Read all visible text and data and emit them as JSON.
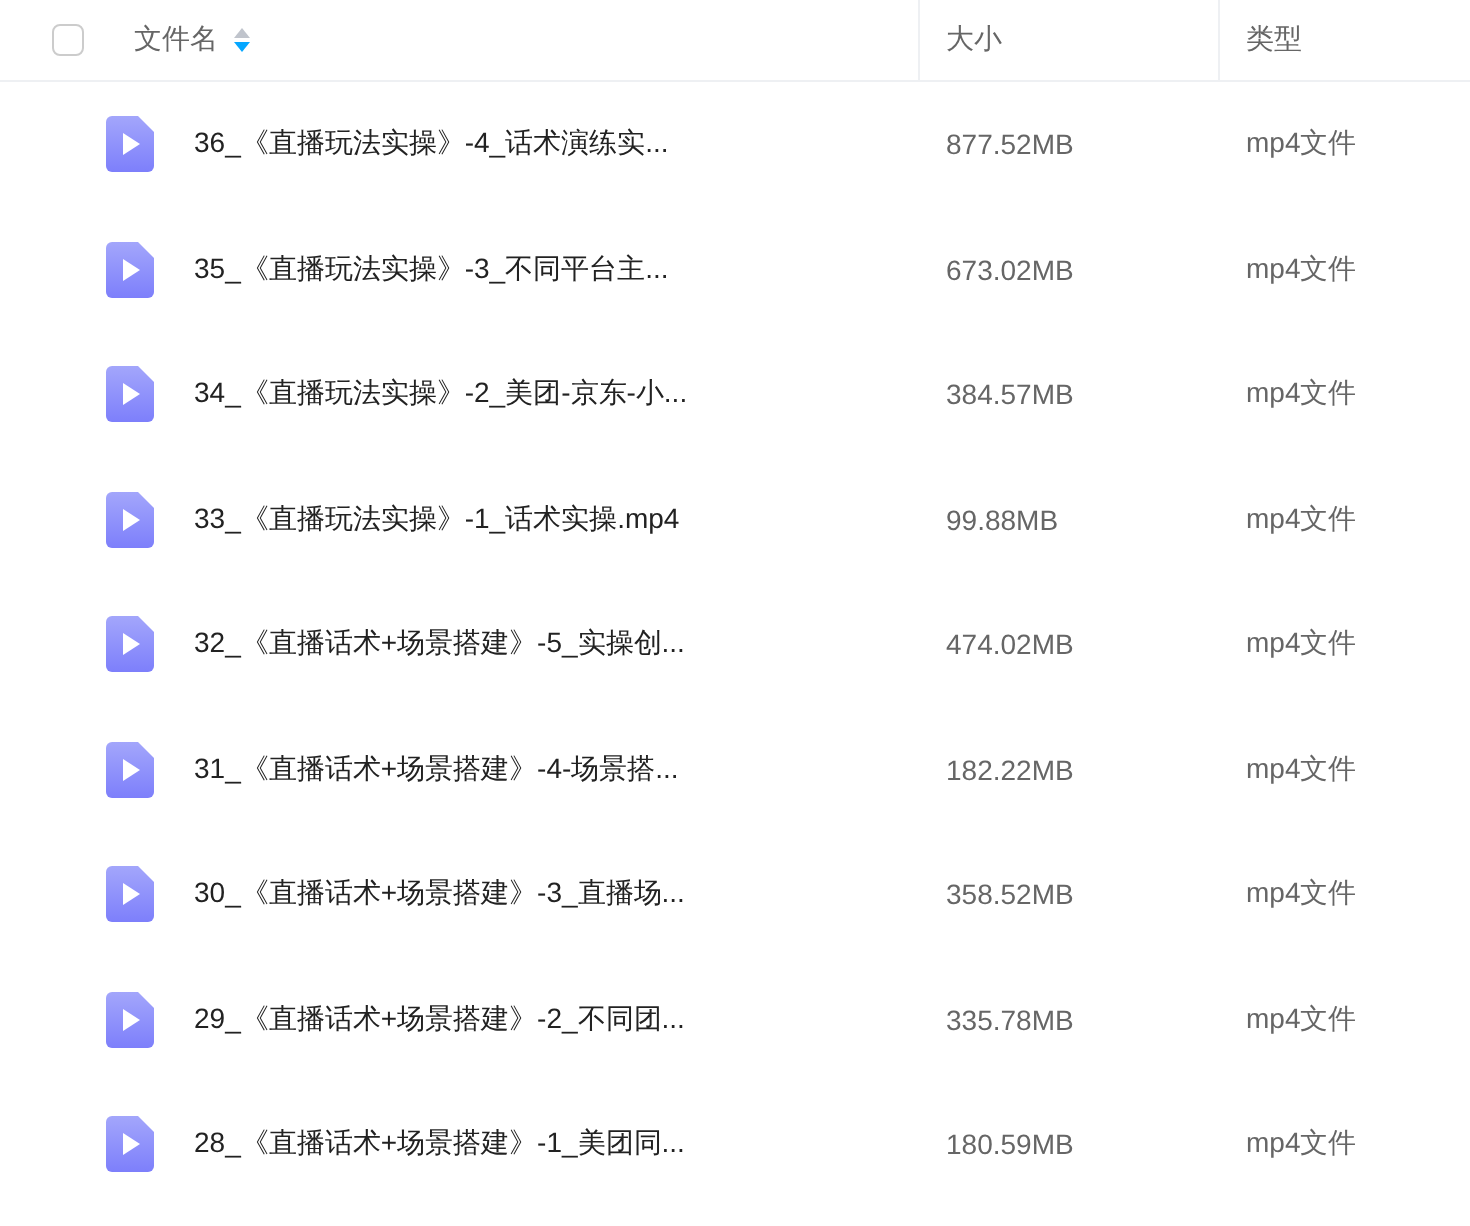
{
  "table": {
    "select_all": {
      "checked": false
    },
    "columns": [
      {
        "label": "文件名",
        "sorted": true,
        "descending": true
      },
      {
        "label": "大小",
        "sorted": false
      },
      {
        "label": "类型",
        "sorted": false
      }
    ],
    "rows": [
      {
        "name": "36_《直播玩法实操》-4_话术演练实...",
        "size": "877.52MB",
        "type": "mp4文件"
      },
      {
        "name": "35_《直播玩法实操》-3_不同平台主...",
        "size": "673.02MB",
        "type": "mp4文件"
      },
      {
        "name": "34_《直播玩法实操》-2_美团-京东-小...",
        "size": "384.57MB",
        "type": "mp4文件"
      },
      {
        "name": "33_《直播玩法实操》-1_话术实操.mp4",
        "size": "99.88MB",
        "type": "mp4文件"
      },
      {
        "name": "32_《直播话术+场景搭建》-5_实操创...",
        "size": "474.02MB",
        "type": "mp4文件"
      },
      {
        "name": "31_《直播话术+场景搭建》-4-场景搭...",
        "size": "182.22MB",
        "type": "mp4文件"
      },
      {
        "name": "30_《直播话术+场景搭建》-3_直播场...",
        "size": "358.52MB",
        "type": "mp4文件"
      },
      {
        "name": "29_《直播话术+场景搭建》-2_不同团...",
        "size": "335.78MB",
        "type": "mp4文件"
      },
      {
        "name": "28_《直播话术+场景搭建》-1_美团同...",
        "size": "180.59MB",
        "type": "mp4文件"
      }
    ]
  }
}
